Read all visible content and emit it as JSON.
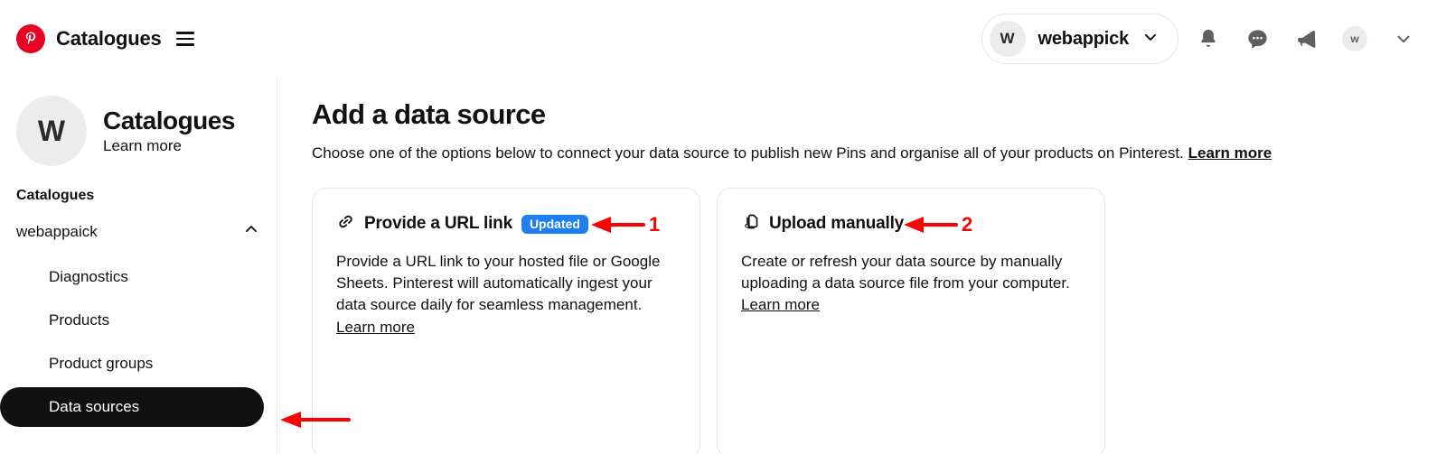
{
  "topbar": {
    "logo_alt": "Pinterest",
    "brand_title": "Catalogues",
    "menu_icon": "hamburger-icon",
    "account": {
      "avatar_initial": "W",
      "name": "webappick",
      "chevron": "chevron-down-icon"
    },
    "icons": [
      {
        "name": "notifications-bell-icon"
      },
      {
        "name": "messages-chat-icon"
      },
      {
        "name": "announcements-megaphone-icon"
      }
    ],
    "mini_avatar_initial": "w",
    "end_chevron": "chevron-down-icon"
  },
  "sidebar": {
    "avatar_initial": "W",
    "title": "Catalogues",
    "learn_more": "Learn more",
    "section_label": "Catalogues",
    "account_row": {
      "label": "webappaick",
      "chevron": "chevron-up-icon"
    },
    "items": [
      {
        "label": "Diagnostics",
        "active": false
      },
      {
        "label": "Products",
        "active": false
      },
      {
        "label": "Product groups",
        "active": false
      },
      {
        "label": "Data sources",
        "active": true
      }
    ]
  },
  "main": {
    "title": "Add a data source",
    "subtitle": "Choose one of the options below to connect your data source to publish new Pins and organise all of your products on Pinterest.",
    "subtitle_link": "Learn more",
    "cards": [
      {
        "icon": "link-chain-icon",
        "title": "Provide a URL link",
        "badge": "Updated",
        "body": "Provide a URL link to your hosted file or Google Sheets. Pinterest will automatically ingest your data source daily for seamless management.",
        "body_link": "Learn more"
      },
      {
        "icon": "add-file-icon",
        "title": "Upload manually",
        "badge": "",
        "body": "Create or refresh your data source by manually uploading a data source file from your computer.",
        "body_link": "Learn more"
      }
    ]
  },
  "annotations": {
    "color": "#ff0000",
    "markers": [
      {
        "label": "1",
        "points_to": "provide-a-url-link-card"
      },
      {
        "label": "2",
        "points_to": "upload-manually-card"
      },
      {
        "label": "",
        "points_to": "sidebar-item-data-sources"
      }
    ]
  },
  "colors": {
    "brand_red": "#e60023",
    "badge_blue": "#1d7ff0",
    "active_nav": "#111111",
    "annotation_red": "#ff0000"
  }
}
